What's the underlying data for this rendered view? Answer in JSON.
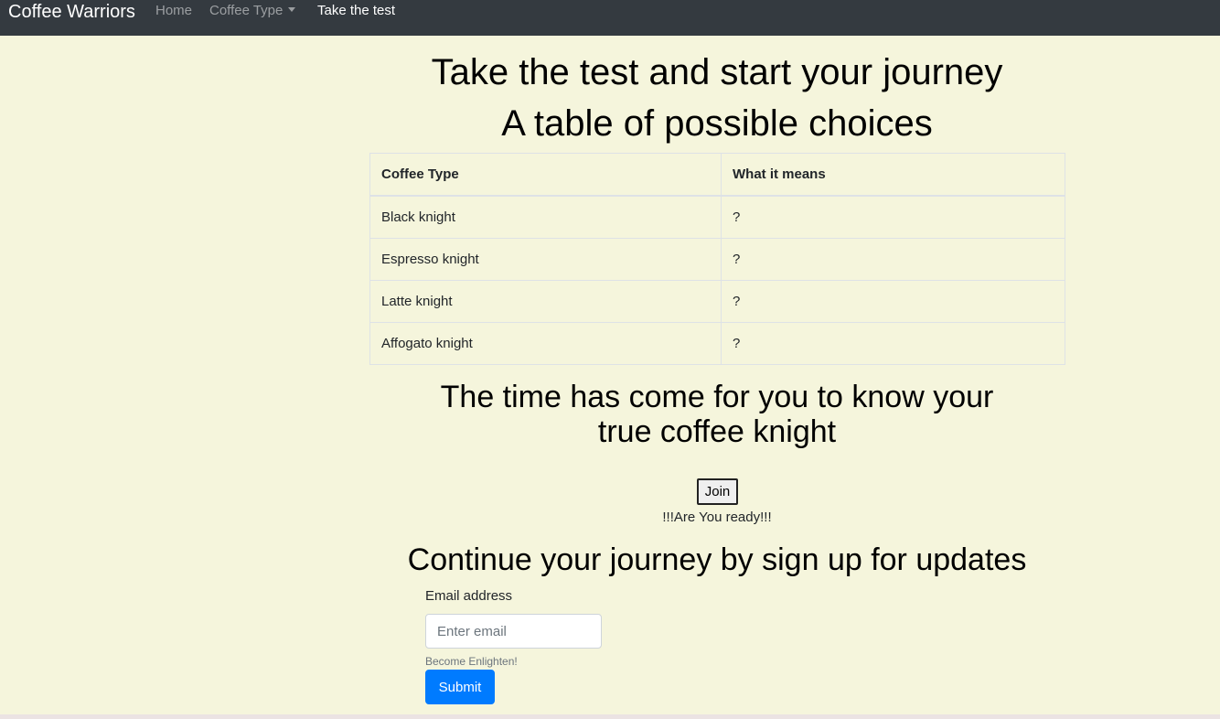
{
  "navbar": {
    "brand": "Coffee Warriors",
    "links": [
      {
        "label": "Home"
      },
      {
        "label": "Coffee Type"
      },
      {
        "label": "Take the test"
      }
    ]
  },
  "main": {
    "title": "Take the test and start your journey",
    "table_heading": "A table of possible choices",
    "table": {
      "headers": [
        "Coffee Type",
        "What it means"
      ],
      "rows": [
        [
          "Black knight",
          "?"
        ],
        [
          "Espresso knight",
          "?"
        ],
        [
          "Latte knight",
          "?"
        ],
        [
          "Affogato knight",
          "?"
        ]
      ]
    },
    "prompt_line1": "The time has come for you to know your",
    "prompt_line2": "true coffee knight",
    "join_label": "Join",
    "ready_text": "!!!Are You ready!!!",
    "signup_heading": "Continue your journey by sign up for updates"
  },
  "form": {
    "email_label": "Email address",
    "email_placeholder": "Enter email",
    "email_value": "",
    "help_text": "Become Enlighten!",
    "submit_label": "Submit"
  },
  "colors": {
    "background": "#f5f5dc",
    "navbar": "#343a40",
    "primary": "#007bff"
  }
}
